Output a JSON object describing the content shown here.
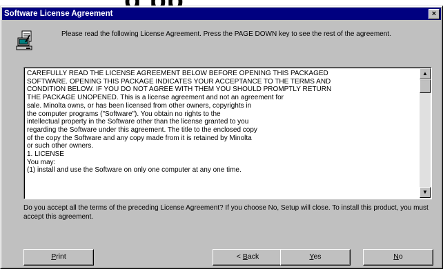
{
  "background_heading": "g        pp",
  "dialog": {
    "title": "Software License Agreement",
    "close_symbol": "×",
    "instruction": "Please read the following License Agreement. Press the PAGE DOWN key to see the rest of the agreement.",
    "license_text": "CAREFULLY READ THE LICENSE AGREEMENT BELOW BEFORE OPENING THIS PACKAGED\nSOFTWARE. OPENING THIS PACKAGE INDICATES YOUR ACCEPTANCE TO THE TERMS AND\nCONDITION BELOW. IF YOU DO NOT AGREE WITH THEM YOU SHOULD PROMPTLY RETURN\nTHE PACKAGE UNOPENED. This is a license agreement and not an agreement for\nsale. Minolta owns, or has been licensed from other owners, copyrights in\nthe computer programs (\"Software\"). You obtain no rights to the\nintellectual property in the Software other than the license granted to you\nregarding the Software under this agreement. The title to the enclosed copy\nof the copy the Software and any copy made from it is retained by Minolta\nor such other owners.\n1. LICENSE\nYou may:\n(1) install and use the Software on only one computer at any one time.",
    "question": "Do you accept all the terms of the preceding License Agreement? If you choose No, Setup will close. To install this product, you must accept this agreement.",
    "scroll_up": "▲",
    "scroll_down": "▼",
    "buttons": {
      "print_mnemonic": "P",
      "print_rest": "rint",
      "back_prefix": "< ",
      "back_mnemonic": "B",
      "back_rest": "ack",
      "yes_mnemonic": "Y",
      "yes_rest": "es",
      "no_mnemonic": "N",
      "no_rest": "o"
    }
  }
}
